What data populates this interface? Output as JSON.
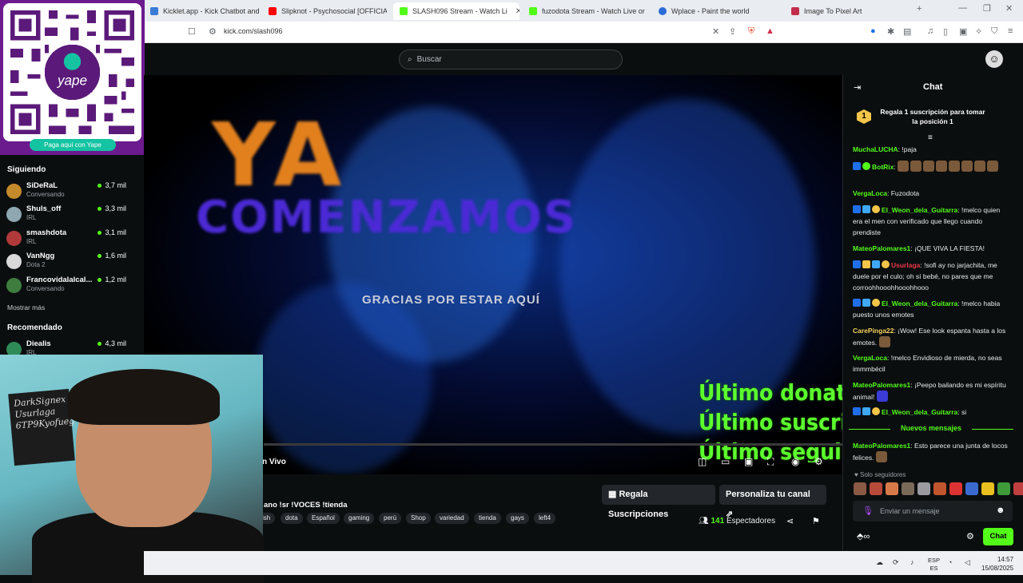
{
  "browser": {
    "tabs": [
      {
        "label": "Kicklet.app - Kick Chatbot and Overl",
        "color": "#3a7bd5"
      },
      {
        "label": "Slipknot - Psychosocial [OFFICIAL",
        "color": "#ff0000"
      },
      {
        "label": "SLASH096 Stream - Watch Li",
        "color": "#53fc18",
        "active": true
      },
      {
        "label": "fuzodota Stream - Watch Live or",
        "color": "#53fc18"
      },
      {
        "label": "Wplace - Paint the world",
        "color": "#2b6cd6"
      },
      {
        "label": "Image To Pixel Art",
        "color": "#c22e4a"
      }
    ],
    "url": "kick.com/slash096"
  },
  "header": {
    "search_placeholder": "Buscar"
  },
  "yape": {
    "logo": "yape",
    "button": "Paga aquí con Yape"
  },
  "sidebar": {
    "following_heading": "Siguiendo",
    "following": [
      {
        "name": "SiDeRaL",
        "category": "Conversando",
        "viewers": "3,7 mil",
        "color": "#c58a2b"
      },
      {
        "name": "Shuls_off",
        "category": "IRL",
        "viewers": "3,3 mil",
        "color": "#8fa7b0"
      },
      {
        "name": "smashdota",
        "category": "IRL",
        "viewers": "3,1 mil",
        "color": "#b03a3a"
      },
      {
        "name": "VanNgg",
        "category": "Dota 2",
        "viewers": "1,6 mil",
        "color": "#d9d9d9"
      },
      {
        "name": "Francovidalalcal...",
        "category": "Conversando",
        "viewers": "1,2 mil",
        "color": "#3e7d3e"
      }
    ],
    "more": "Mostrar más",
    "recommended_heading": "Recomendado",
    "recommended": [
      {
        "name": "Diealis",
        "category": "IRL",
        "viewers": "4,3 mil",
        "color": "#2e8b57"
      }
    ]
  },
  "video": {
    "headline1": "YA",
    "headline2": "COMENZAMOS",
    "subline": "GRACIAS POR ESTAR AQUÍ",
    "overlay_lines": [
      "Último donat",
      "Último suscri",
      "Último segui"
    ],
    "live_label": "n Vivo"
  },
  "stream_info": {
    "title": "ano !sr !VOCES !tienda",
    "tags": [
      "ish",
      "dota",
      "Español",
      "gaming",
      "perú",
      "Shop",
      "variedad",
      "tienda",
      "gays",
      "left4"
    ],
    "gift_button": "Regala Suscripciones",
    "customize_button": "Personaliza tu canal",
    "viewers_count": "141",
    "viewers_label": "Espectadores"
  },
  "chat": {
    "title": "Chat",
    "gift_prompt": "Regala 1 suscripción para tomar la posición 1",
    "gift_rank": "1",
    "messages": [
      {
        "user": "MuchaLUCHA",
        "color": "#53fc18",
        "text": ": !paja"
      },
      {
        "user": "BotRix",
        "color": "#53fc18",
        "text": ":"
      },
      {
        "user": "VergaLoca",
        "color": "#53fc18",
        "text": ": Fuzodota"
      },
      {
        "user": "El_Weon_dela_Guitarra",
        "color": "#53fc18",
        "text": ": !melco quien era el men con verificado que llego cuando prendiste"
      },
      {
        "user": "MateoPalomares1",
        "color": "#53fc18",
        "text": ": ¡QUE VIVA LA FIESTA!"
      },
      {
        "user": "Usurlaga",
        "color": "#e63946",
        "text": ": !sofi ay no jarjachita, me duele por el culo; oh sí bebé, no pares que me corroohhooohhooohhooo"
      },
      {
        "user": "El_Weon_dela_Guitarra",
        "color": "#53fc18",
        "text": ": !melco habia puesto unos emotes"
      },
      {
        "user": "CarePinga22",
        "color": "#f4d35e",
        "text": ": ¡Wow! Ese look espanta hasta a los emotes."
      },
      {
        "user": "VergaLoca",
        "color": "#53fc18",
        "text": ": !melco Envidioso de mierda, no seas immmbécil"
      },
      {
        "user": "MateoPalomares1",
        "color": "#53fc18",
        "text": ": ¡Peepo bailando es mi espíritu animal!"
      },
      {
        "user": "El_Weon_dela_Guitarra",
        "color": "#53fc18",
        "text": ": si"
      }
    ],
    "new_messages": "Nuevos mensajes",
    "new_message": {
      "user": "MateoPalomares1",
      "color": "#53fc18",
      "text": ": Esto parece una junta de locos felices."
    },
    "followers_only": "Solo seguidores",
    "input_placeholder": "Enviar un mensaje",
    "send_button": "Chat"
  },
  "webcam": {
    "poster_text": "DarkSignex Usurlaga 6TP9Kyofueg"
  },
  "taskbar": {
    "lang_top": "ESP",
    "lang_bottom": "ES",
    "time": "14:57",
    "date": "15/08/2025"
  },
  "colors": {
    "kick_green": "#53fc18",
    "bg": "#0b0e0f",
    "yape_purple": "#6b1b8e"
  }
}
